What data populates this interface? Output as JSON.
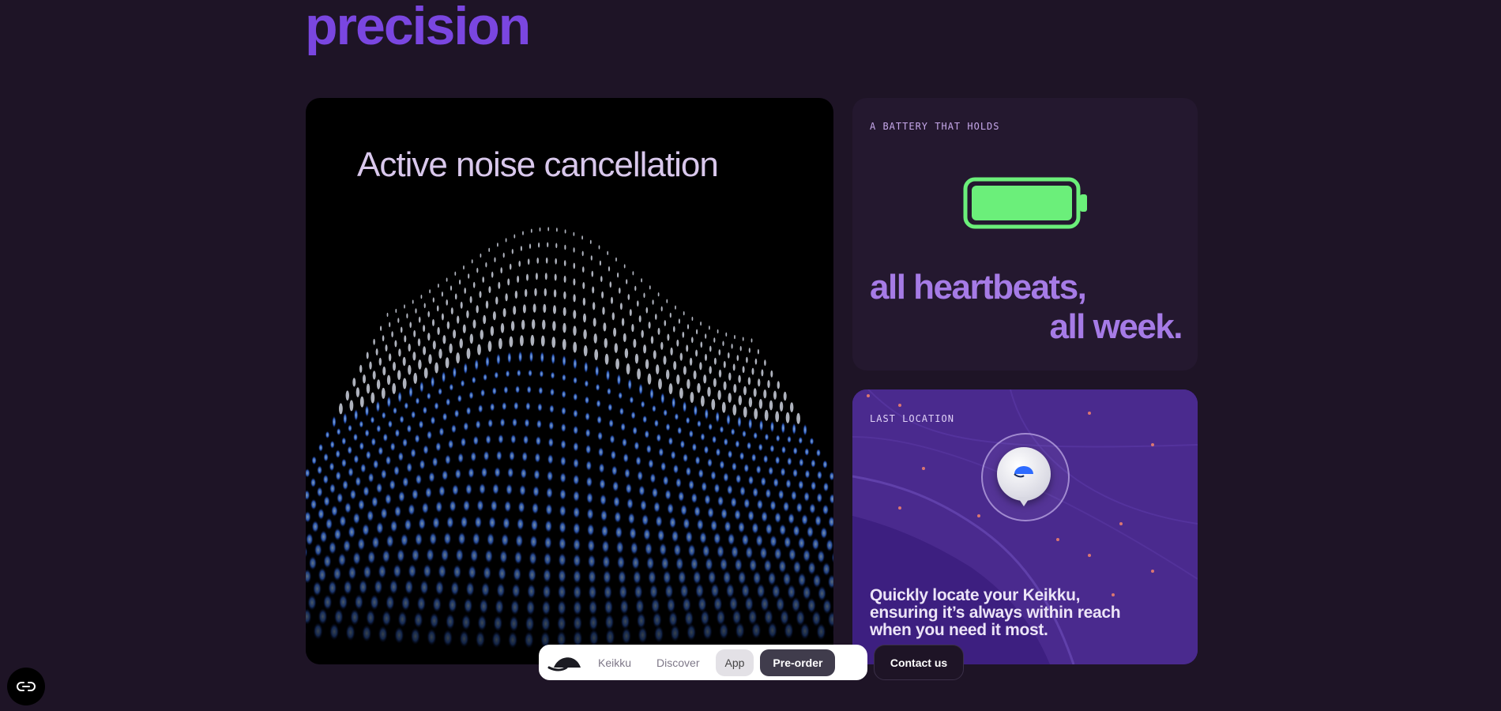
{
  "headline": "precision",
  "anc_card": {
    "title": "Active noise cancellation"
  },
  "battery_card": {
    "label": "A BATTERY THAT HOLDS",
    "line1": "all heartbeats,",
    "line2": "all week.",
    "fill_fraction": 1.0
  },
  "location_card": {
    "label": "LAST LOCATION",
    "text": "Quickly locate your Keikku, ensuring it’s always within reach when you need it most."
  },
  "nav": {
    "items": [
      "Keikku",
      "Discover",
      "App",
      "Pre-order"
    ],
    "contact": "Contact us"
  },
  "colors": {
    "background": "#1e1426",
    "headline": "#7a46e0",
    "battery_green": "#6bef7a",
    "map_purple": "#3a1c7a"
  },
  "icons": {
    "brand_logo": "keikku-logo-icon",
    "corner_button": "chain-link-icon",
    "battery": "battery-full-icon",
    "pin": "location-pin-icon"
  }
}
